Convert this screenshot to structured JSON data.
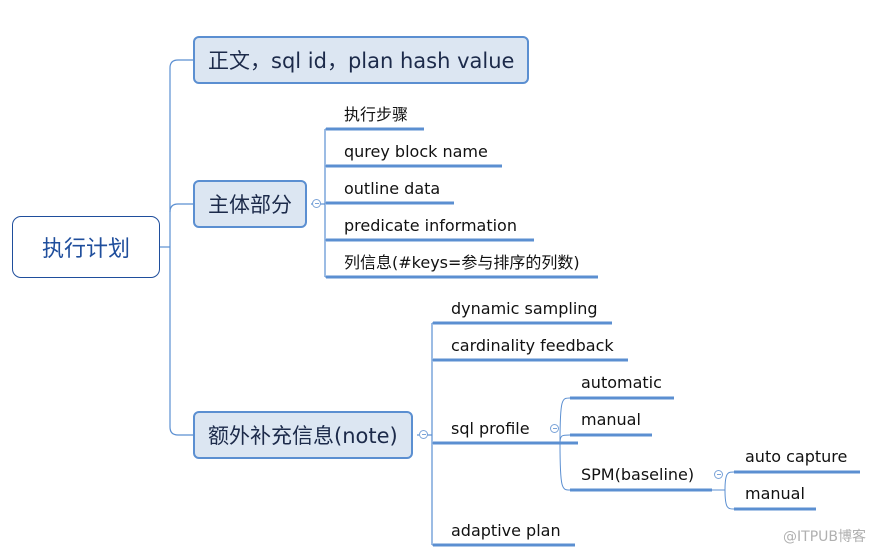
{
  "root": {
    "label": "执行计划"
  },
  "branches": [
    {
      "label": "正文，sql id，plan hash value"
    },
    {
      "label": "主体部分",
      "children": [
        {
          "label": "执行步骤"
        },
        {
          "label": "qurey block name"
        },
        {
          "label": "outline data"
        },
        {
          "label": "predicate information"
        },
        {
          "label": "列信息(#keys=参与排序的列数)"
        }
      ]
    },
    {
      "label": "额外补充信息(note)",
      "children": [
        {
          "label": "dynamic sampling"
        },
        {
          "label": "cardinality feedback"
        },
        {
          "label": "sql profile",
          "children": [
            {
              "label": "automatic"
            },
            {
              "label": "manual"
            },
            {
              "label": "SPM(baseline)",
              "children": [
                {
                  "label": "auto capture"
                },
                {
                  "label": "manual"
                }
              ]
            }
          ]
        },
        {
          "label": "adaptive plan"
        }
      ]
    }
  ],
  "colors": {
    "line": "#5b8fd1",
    "thin_line": "#7aa3d8",
    "root_border": "#1f4e9c",
    "box_fill": "#dce6f2"
  },
  "watermark": "@ITPUB博客"
}
